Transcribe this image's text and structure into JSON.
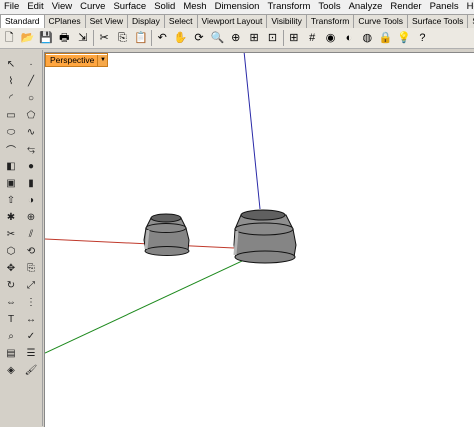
{
  "menu": [
    "File",
    "Edit",
    "View",
    "Curve",
    "Surface",
    "Solid",
    "Mesh",
    "Dimension",
    "Transform",
    "Tools",
    "Analyze",
    "Render",
    "Panels",
    "Help"
  ],
  "tabs": [
    "Standard",
    "CPlanes",
    "Set View",
    "Display",
    "Select",
    "Viewport Layout",
    "Visibility",
    "Transform",
    "Curve Tools",
    "Surface Tools",
    "Solid"
  ],
  "toolbar_icons": [
    "new-file-icon",
    "open-folder-icon",
    "save-icon",
    "print-icon",
    "import-icon",
    "cut-icon",
    "copy-icon",
    "paste-icon",
    "undo-icon",
    "pan-hand-icon",
    "rotate-view-icon",
    "zoom-icon",
    "zoom-window-icon",
    "zoom-extents-icon",
    "zoom-selected-icon",
    "four-viewports-icon",
    "grid-icon",
    "render-icon",
    "shade-icon",
    "material-icon",
    "lock-icon",
    "bulb-icon",
    "help-icon"
  ],
  "left_toolbar_icons": [
    "select-arrow-icon",
    "point-icon",
    "polyline-icon",
    "line-icon",
    "arc-icon",
    "circle-icon",
    "rectangle-icon",
    "polygon-icon",
    "ellipse-icon",
    "curve-icon",
    "fillet-curve-icon",
    "offset-icon",
    "surface-icon",
    "sphere-icon",
    "box-icon",
    "cylinder-icon",
    "extrude-icon",
    "boolean-icon",
    "explode-icon",
    "join-icon",
    "trim-icon",
    "split-icon",
    "mesh-icon",
    "rebuild-icon",
    "move-icon",
    "copy-object-icon",
    "rotate-icon",
    "scale-icon",
    "mirror-icon",
    "array-icon",
    "text-icon",
    "dimension-icon",
    "analyze-icon",
    "check-icon",
    "layer-icon",
    "properties-icon",
    "render-tool-icon",
    "paint-icon"
  ],
  "viewport": {
    "title": "Perspective",
    "axis_colors": {
      "x": "#c0392b",
      "y": "#1e8a1e",
      "z": "#2a2aa8"
    },
    "object_color": "#8a8a8a"
  }
}
